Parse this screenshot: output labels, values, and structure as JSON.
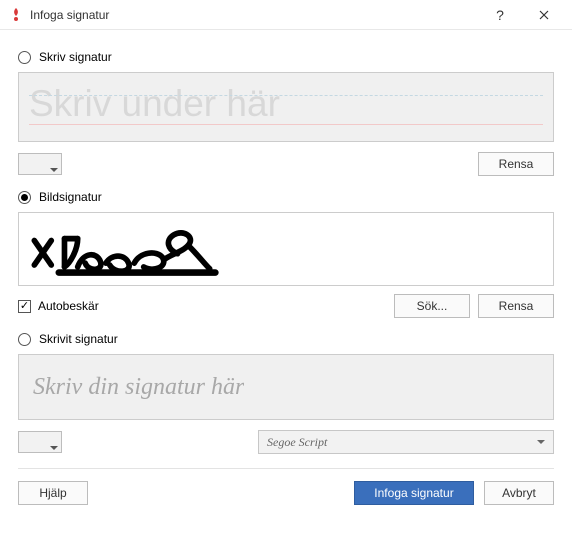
{
  "titlebar": {
    "title": "Infoga signatur"
  },
  "options": {
    "draw": {
      "label": "Skriv signatur",
      "placeholder": "Skriv under här",
      "clear": "Rensa"
    },
    "image": {
      "label": "Bildsignatur",
      "autocrop": "Autobeskär",
      "browse": "Sök...",
      "clear": "Rensa"
    },
    "type": {
      "label": "Skrivit signatur",
      "placeholder": "Skriv din signatur här",
      "font": "Segoe Script"
    }
  },
  "footer": {
    "help": "Hjälp",
    "insert": "Infoga signatur",
    "cancel": "Avbryt"
  }
}
